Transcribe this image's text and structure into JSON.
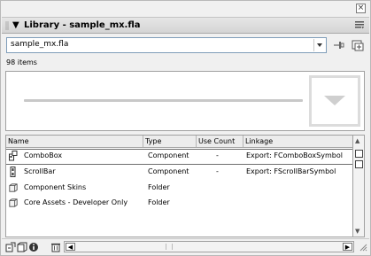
{
  "panel": {
    "title": "Library - sample_mx.fla",
    "close_glyph": "×"
  },
  "doc_selector": {
    "value": "sample_mx.fla"
  },
  "status": {
    "item_count": "98 items"
  },
  "columns": [
    {
      "label": "Name"
    },
    {
      "label": "Type"
    },
    {
      "label": "Use Count"
    },
    {
      "label": "Linkage"
    }
  ],
  "items": [
    {
      "name": "ComboBox",
      "type": "Component",
      "use_count": "-",
      "linkage": "Export: FComboBoxSymbol",
      "icon": "component-icon"
    },
    {
      "name": "ScrollBar",
      "type": "Component",
      "use_count": "-",
      "linkage": "Export: FScrollBarSymbol",
      "icon": "component-icon"
    },
    {
      "name": "Component Skins",
      "type": "Folder",
      "use_count": "",
      "linkage": "",
      "icon": "folder-icon"
    },
    {
      "name": "Core Assets - Developer Only",
      "type": "Folder",
      "use_count": "",
      "linkage": "",
      "icon": "folder-icon"
    }
  ],
  "colors": {
    "panel_bg": "#f0f0f0",
    "list_bg": "#ffffff",
    "border": "#a0a0a0"
  }
}
